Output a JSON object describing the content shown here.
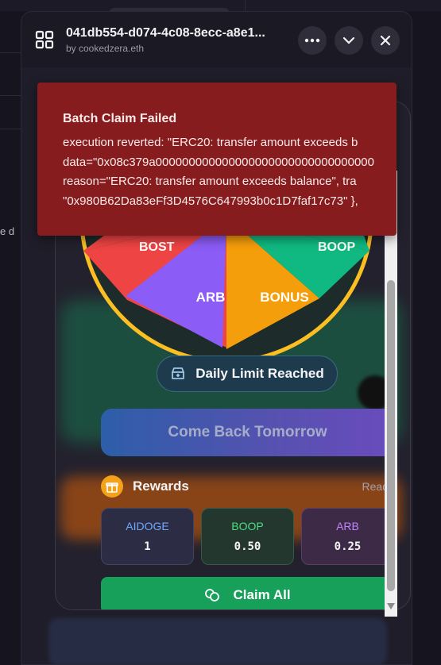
{
  "background": {
    "partial_text": "e d"
  },
  "window": {
    "title": "041db554-d074-4c08-8ecc-a8e1...",
    "subtitle": "by cookedzera.eth",
    "more_icon": "ellipsis-icon",
    "collapse_icon": "chevron-down-icon",
    "close_icon": "close-icon"
  },
  "wheel": {
    "segments": [
      {
        "label": "BOST",
        "color": "#ef4444"
      },
      {
        "label": "ARB",
        "color": "#8b5cf6"
      },
      {
        "label": "BONUS",
        "color": "#f59e0b"
      },
      {
        "label": "BOOP",
        "color": "#10b981"
      }
    ],
    "rim_color": "#fbbf24"
  },
  "spin": {
    "limit_label": "Daily Limit Reached",
    "cta_label": "Come Back Tomorrow"
  },
  "rewards": {
    "title": "Rewards",
    "status": "Ready",
    "items": [
      {
        "name": "AIDOGE",
        "value": "1",
        "color": "#6ea8ff"
      },
      {
        "name": "BOOP",
        "value": "0.50",
        "color": "#4ade80"
      },
      {
        "name": "ARB",
        "value": "0.25",
        "color": "#c084fc"
      }
    ],
    "claim_label": "Claim All"
  },
  "toast": {
    "title": "Batch Claim Failed",
    "lines": [
      "execution reverted: \"ERC20: transfer amount exceeds b",
      "data=\"0x08c379a000000000000000000000000000000000",
      "reason=\"ERC20: transfer amount exceeds balance\", tra",
      "\"0x980B62Da83eFf3D4576C647993b0c1D7faf17c73\" },"
    ]
  }
}
